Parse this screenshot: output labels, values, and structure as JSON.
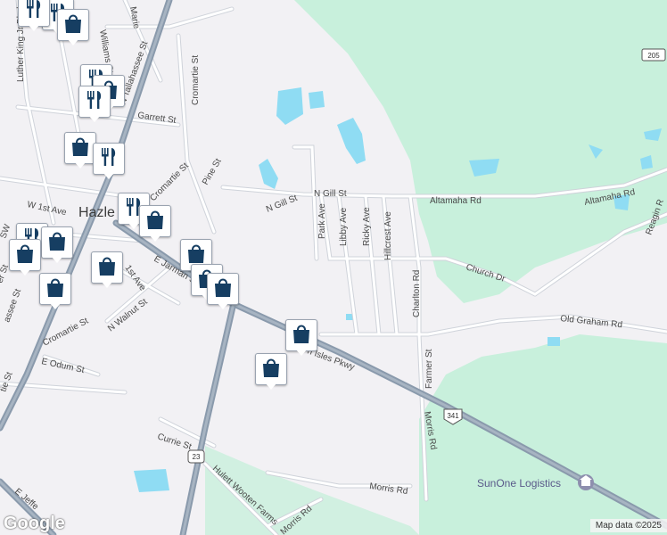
{
  "map": {
    "city_label": "Hazle",
    "poi_label": "SunOne Logistics",
    "attribution": "Map data ©2025",
    "google_logo": "Google",
    "route_shields": {
      "us341": "341",
      "sr23": "23",
      "sr205": "205"
    },
    "streets": {
      "n_gill_st_1": "N Gill St",
      "n_gill_st_2": "N Gill St",
      "altamaha_rd_1": "Altamaha Rd",
      "altamaha_rd_2": "Altamaha Rd",
      "park_ave": "Park Ave",
      "libby_ave": "Libby Ave",
      "ricky_ave": "Ricky Ave",
      "hillcrest_ave": "Hillcrest Ave",
      "charlton_rd": "Charlton Rd",
      "church_dr": "Church Dr",
      "old_graham_rd": "Old Graham Rd",
      "farmer_st": "Farmer St",
      "morris_rd_1": "Morris Rd",
      "morris_rd_2": "Morris Rd",
      "morris_rd_3": "Morris Rd",
      "isles_pkwy": "n Isles Pkwy",
      "garrett_st": "Garrett St",
      "cromartie_st_1": "Cromartie St",
      "cromartie_st_2": "Cromartie St",
      "cromartie_st_3": "Cromartie St",
      "pine_st": "Pine St",
      "w_1st_ave": "W 1st Ave",
      "e_1st_ave": "1st Ave",
      "e_jarman": "E Jarman St",
      "n_walnut_st": "N Walnut St",
      "e_odum_st": "E Odum St",
      "currie_st": "Currie St",
      "hulett_wooten": "Hulett Wooten Farms",
      "n_tallahassee_st": "N Tallahassee St",
      "tallahassee_st": "assee St",
      "luther_king": "Luther King Jr Blvd",
      "williams_st": "Williams St",
      "marie": "Marie",
      "reagin_rd": "Reagin R",
      "e_jeff": "E Jeffe",
      "er_st": "er St",
      "sw": "SW",
      "tie_st": "tie St"
    }
  },
  "markers": [
    {
      "type": "restaurant",
      "icon": "fork-knife-icon"
    },
    {
      "type": "shopping",
      "icon": "shopping-bag-icon"
    },
    {
      "type": "restaurant",
      "icon": "fork-knife-icon"
    },
    {
      "type": "shopping",
      "icon": "shopping-bag-icon"
    },
    {
      "type": "restaurant",
      "icon": "fork-knife-icon"
    },
    {
      "type": "shopping",
      "icon": "shopping-bag-icon"
    },
    {
      "type": "restaurant",
      "icon": "fork-knife-icon"
    },
    {
      "type": "restaurant",
      "icon": "fork-knife-icon"
    },
    {
      "type": "shopping",
      "icon": "shopping-bag-icon"
    },
    {
      "type": "restaurant",
      "icon": "fork-knife-icon"
    },
    {
      "type": "shopping",
      "icon": "shopping-bag-icon"
    },
    {
      "type": "shopping",
      "icon": "shopping-bag-icon"
    },
    {
      "type": "shopping",
      "icon": "shopping-bag-icon"
    },
    {
      "type": "shopping",
      "icon": "shopping-bag-icon"
    },
    {
      "type": "shopping",
      "icon": "shopping-bag-icon"
    },
    {
      "type": "shopping",
      "icon": "shopping-bag-icon"
    },
    {
      "type": "shopping",
      "icon": "shopping-bag-icon"
    },
    {
      "type": "shopping",
      "icon": "shopping-bag-icon"
    },
    {
      "type": "shopping",
      "icon": "shopping-bag-icon"
    },
    {
      "type": "restaurant",
      "icon": "fork-knife-icon"
    }
  ],
  "colors": {
    "land": "#f2f1f4",
    "park": "#c8f0dc",
    "water": "#8fdcf3",
    "highway": "#8a9aac",
    "road": "#ffffff",
    "road_outline": "#cfd3da",
    "marker_icon": "#163e62"
  }
}
